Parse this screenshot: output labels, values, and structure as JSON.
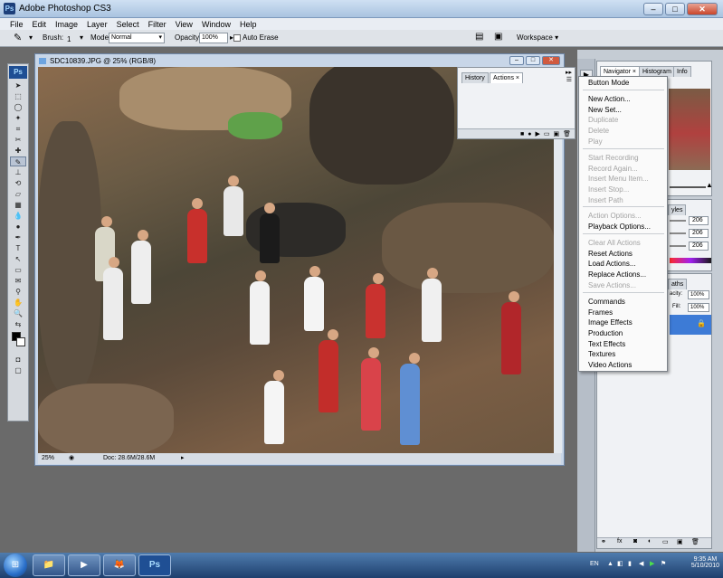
{
  "app": {
    "window_title": "Adobe Photoshop CS3",
    "title_buttons": [
      "–",
      "□",
      "✕"
    ]
  },
  "menubar": [
    "File",
    "Edit",
    "Image",
    "Layer",
    "Select",
    "Filter",
    "View",
    "Window",
    "Help"
  ],
  "options": {
    "brush_label": "Brush:",
    "brush_size": "1",
    "mode_label": "Mode:",
    "mode_value": "Normal",
    "opacity_label": "Opacity:",
    "opacity_value": "100%",
    "auto_erase_label": "Auto Erase",
    "workspace_label": "Workspace ▾"
  },
  "document": {
    "title": "SDC10839.JPG @ 25% (RGB/8)",
    "zoom": "25%",
    "doc_info": "Doc: 28.6M/28.6M"
  },
  "actions_panel": {
    "tabs": [
      "History",
      "Actions ×"
    ]
  },
  "nav_panel": {
    "tabs": [
      "Navigator ×",
      "Histogram",
      "Info"
    ]
  },
  "color_panel": {
    "tab": "yles",
    "values": [
      "206",
      "206",
      "206"
    ]
  },
  "layers_panel": {
    "tab": "aths",
    "opacity_label": "acity:",
    "opacity_value": "100%",
    "fill_label": "Fill:",
    "fill_value": "100%"
  },
  "flyout_menu": [
    {
      "label": "Button Mode",
      "disabled": false
    },
    {
      "label": "New Action...",
      "disabled": false
    },
    {
      "label": "New Set...",
      "disabled": false
    },
    {
      "label": "Duplicate",
      "disabled": true
    },
    {
      "label": "Delete",
      "disabled": true
    },
    {
      "label": "Play",
      "disabled": true
    },
    {
      "label": "Start Recording",
      "disabled": true
    },
    {
      "label": "Record Again...",
      "disabled": true
    },
    {
      "label": "Insert Menu Item...",
      "disabled": true
    },
    {
      "label": "Insert Stop...",
      "disabled": true
    },
    {
      "label": "Insert Path",
      "disabled": true
    },
    {
      "label": "Action Options...",
      "disabled": true
    },
    {
      "label": "Playback Options...",
      "disabled": false
    },
    {
      "label": "Clear All Actions",
      "disabled": true
    },
    {
      "label": "Reset Actions",
      "disabled": false
    },
    {
      "label": "Load Actions...",
      "disabled": false
    },
    {
      "label": "Replace Actions...",
      "disabled": false
    },
    {
      "label": "Save Actions...",
      "disabled": true
    },
    {
      "label": "Commands",
      "disabled": false
    },
    {
      "label": "Frames",
      "disabled": false
    },
    {
      "label": "Image Effects",
      "disabled": false
    },
    {
      "label": "Production",
      "disabled": false
    },
    {
      "label": "Text Effects",
      "disabled": false
    },
    {
      "label": "Textures",
      "disabled": false
    },
    {
      "label": "Video Actions",
      "disabled": false
    }
  ],
  "taskbar": {
    "start_icon": "windows-orb-icon",
    "pinned": [
      {
        "name": "explorer-icon",
        "glyph": "📁"
      },
      {
        "name": "media-player-icon",
        "glyph": "▶"
      },
      {
        "name": "firefox-icon",
        "glyph": "🦊"
      },
      {
        "name": "photoshop-icon",
        "glyph": "Ps"
      }
    ],
    "language": "EN",
    "time": "9:35 AM",
    "date": "5/10/2010"
  },
  "colors": {
    "titlebar": "#a9c3e0",
    "selected_layer": "#3d7bd6",
    "taskbar": "#1e3f6d"
  }
}
